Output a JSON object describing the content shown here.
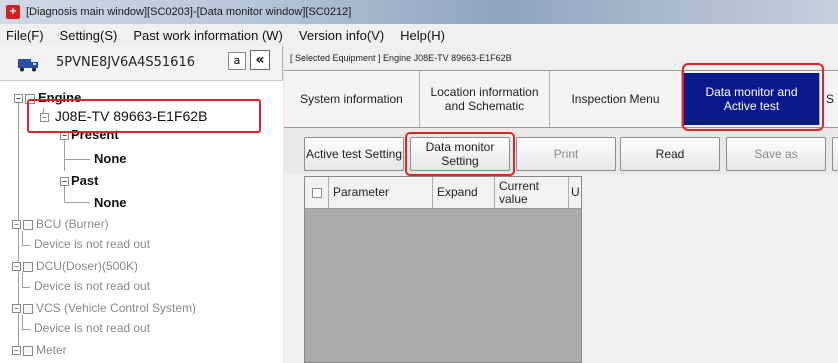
{
  "window": {
    "title": "[Diagnosis main window][SC0203]-[Data monitor window][SC0212]",
    "icon_char": "+"
  },
  "menu": [
    "File(F)",
    "Setting(S)",
    "Past work information (W)",
    "Version info(V)",
    "Help(H)"
  ],
  "left_panel": {
    "vehicle_id": "5PVNE8JV6A4S51616",
    "a_button": "a",
    "collapse_button": "«",
    "tree": {
      "engine": "Engine",
      "engine_model": "J08E-TV 89663-E1F62B",
      "present": "Present",
      "present_value": "None",
      "past": "Past",
      "past_value": "None",
      "bcu": "BCU (Burner)",
      "bcu_status": "Device is not read out",
      "dcu": "DCU(Doser)(500K)",
      "dcu_status": "Device is not read out",
      "vcs": "VCS (Vehicle Control System)",
      "vcs_status": "Device is not read out",
      "meter": "Meter"
    }
  },
  "right_panel": {
    "selected_equipment": "[ Selected Equipment ] Engine J08E-TV 89663-E1F62B",
    "tabs": {
      "system_info": "System information",
      "location": "Location information and Schematic",
      "inspection": "Inspection Menu",
      "data_monitor": "Data monitor and Active test",
      "next": "S"
    },
    "toolbar": {
      "active_test": "Active test Setting",
      "data_monitor_setting": "Data monitor Setting",
      "print": "Print",
      "read": "Read",
      "save_as": "Save as"
    },
    "grid_headers": {
      "parameter": "Parameter",
      "expand": "Expand",
      "current_value": "Current value",
      "unit": "U"
    }
  },
  "colors": {
    "highlight": "#d8262a",
    "active_tab": "#0a1a8c"
  }
}
